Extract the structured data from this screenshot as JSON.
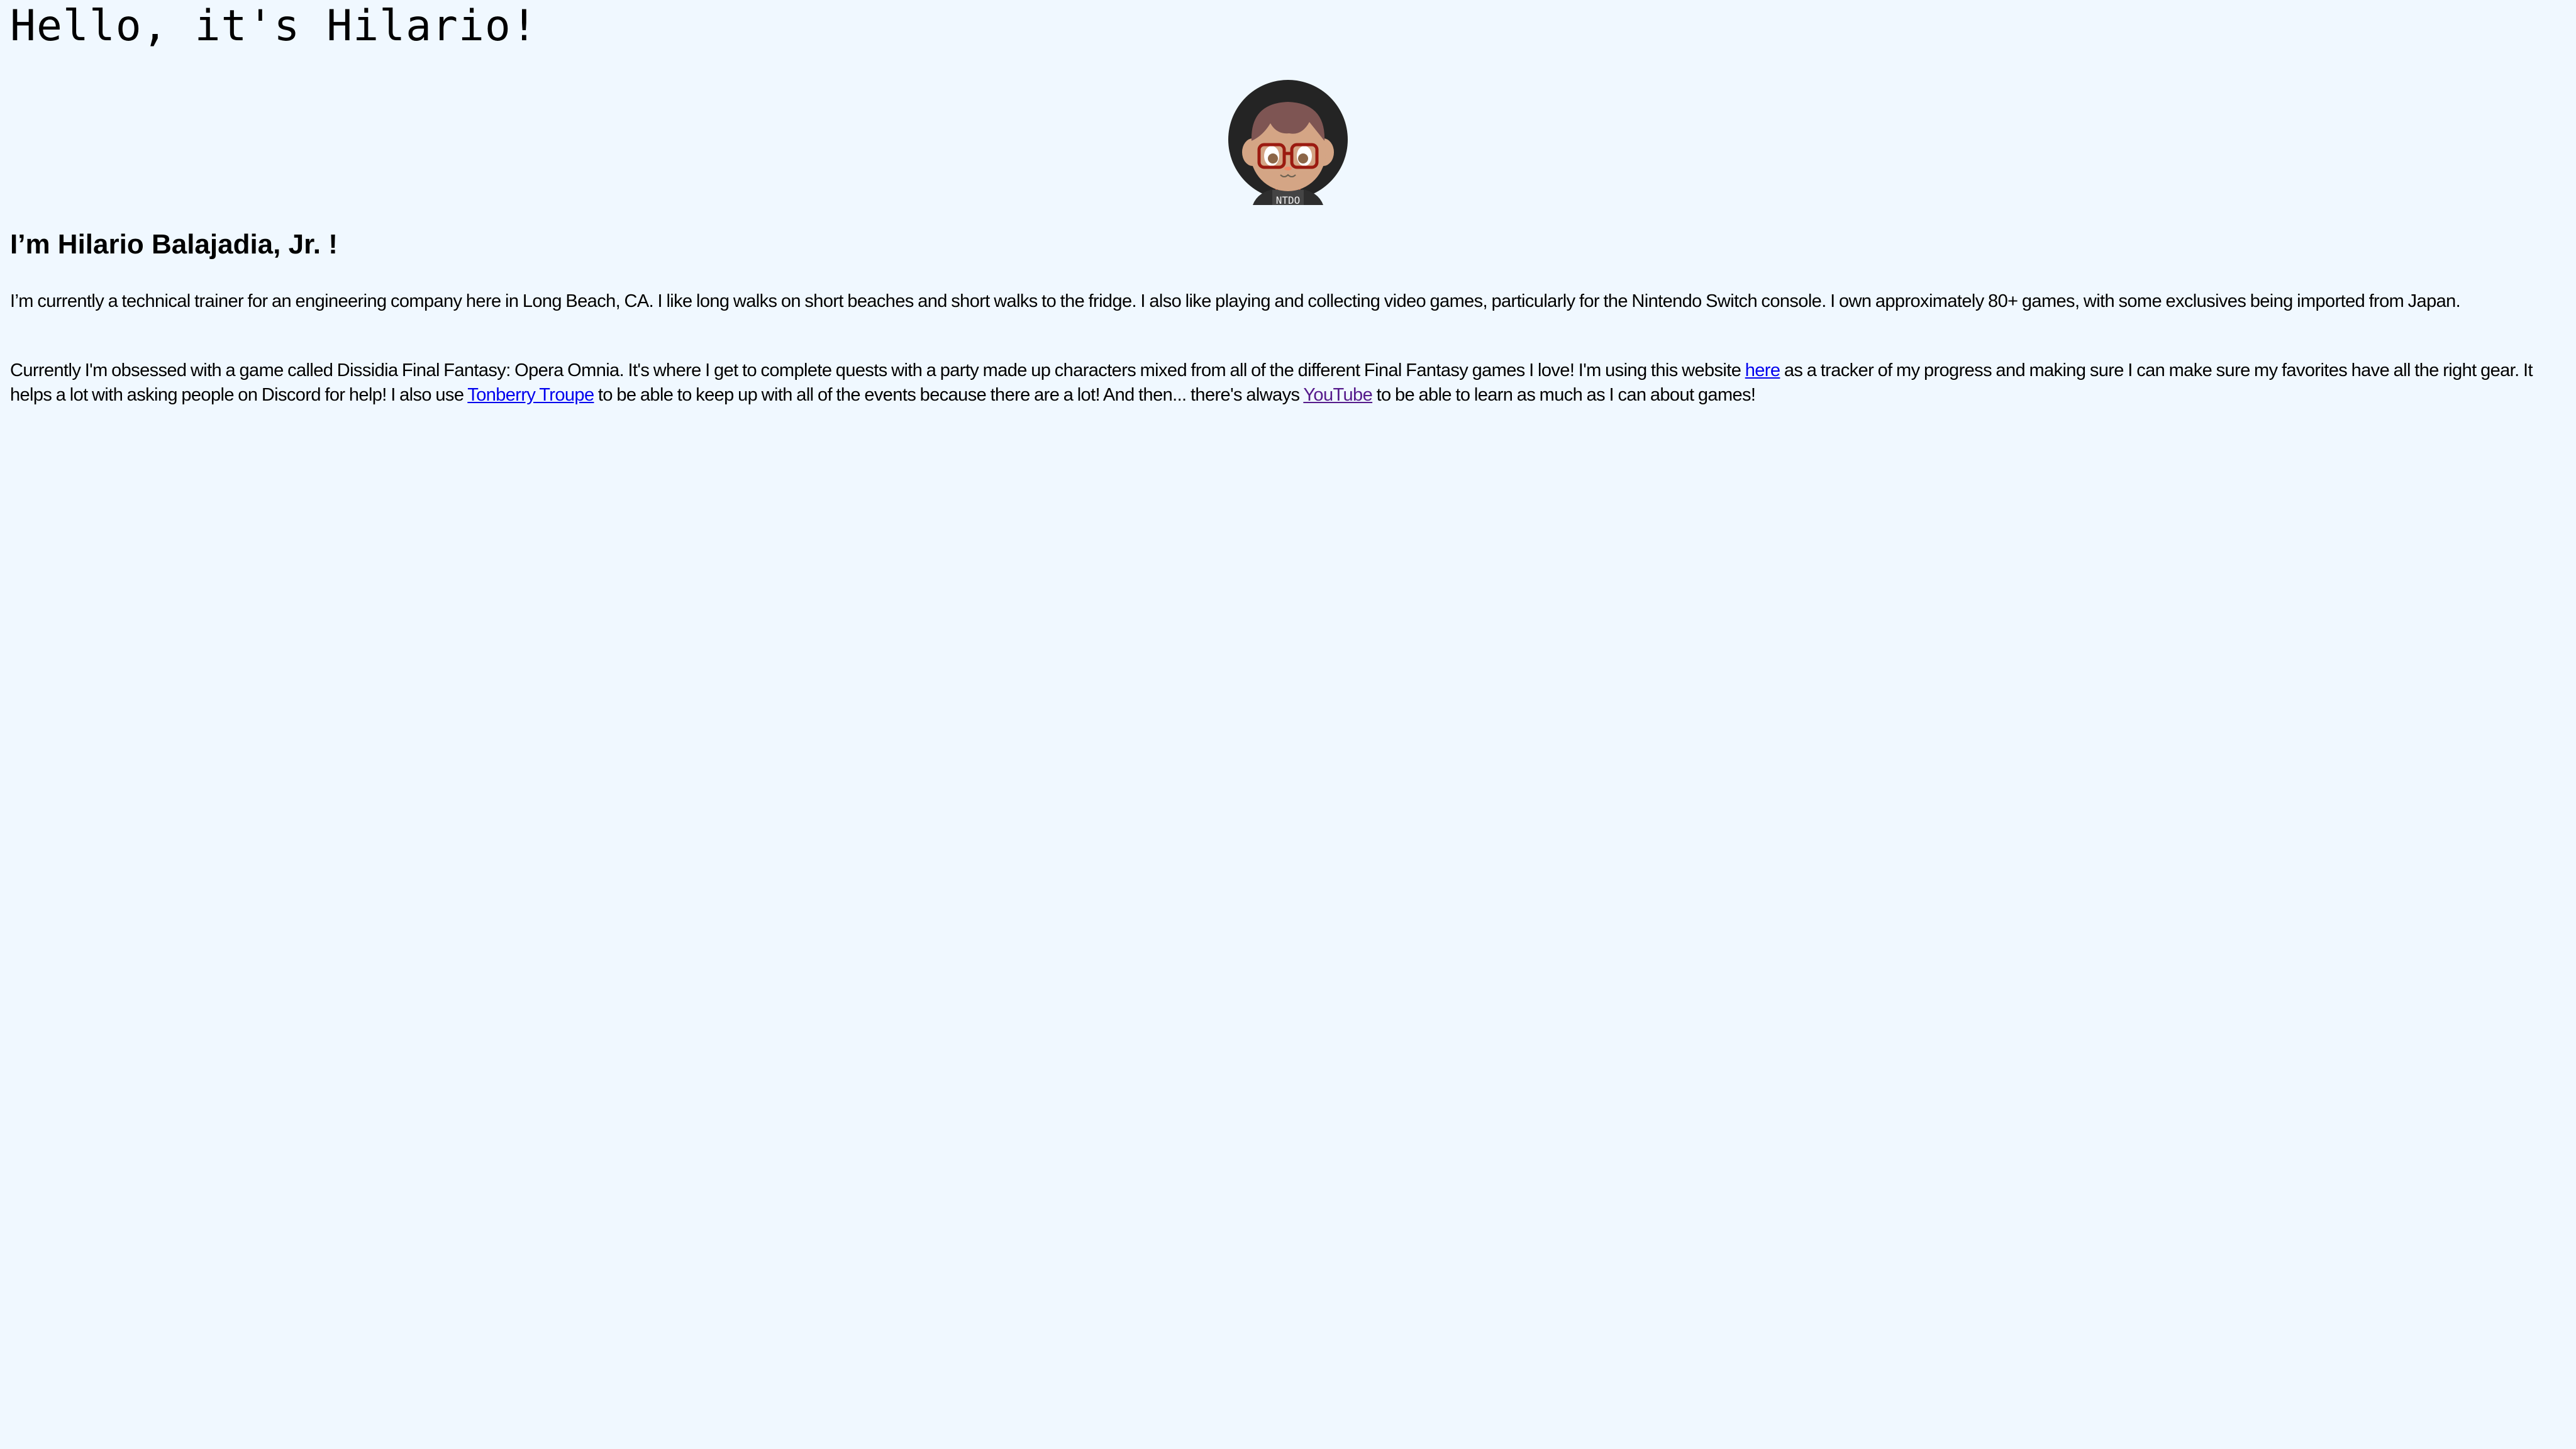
{
  "header": {
    "title": "Hello, it's Hilario!"
  },
  "avatar": {
    "shirt_text": "NTDO"
  },
  "intro": {
    "heading": "I’m Hilario Balajadia, Jr. !"
  },
  "paragraph1": {
    "text": "I’m currently a technical trainer for an engineering company here in Long Beach, CA. I like long walks on short beaches and short walks to the fridge. I also like playing and collecting video games, particularly for the Nintendo Switch console. I own approximately 80+ games, with some exclusives being imported from Japan."
  },
  "paragraph2": {
    "part1": "Currently I'm obsessed with a game called Dissidia Final Fantasy: Opera Omnia. It's where I get to complete quests with a party made up characters mixed from all of the different Final Fantasy games I love! I'm using this website ",
    "link1": "here",
    "part2": " as a tracker of my progress and making sure I can make sure my favorites have all the right gear. It helps a lot with asking people on Discord for help! I also use ",
    "link2": "Tonberry Troupe",
    "part3": " to be able to keep up with all of the events because there are a lot! And then... there's always ",
    "link3": "YouTube",
    "part4": " to be able to learn as much as I can about games!"
  },
  "colors": {
    "background": "#f0f8ff",
    "link": "#0000ee",
    "visited_link": "#551a8b"
  }
}
